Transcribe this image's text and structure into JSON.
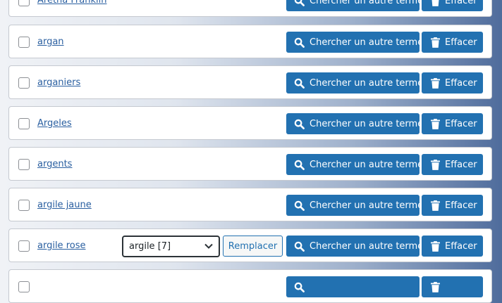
{
  "rows": [
    {
      "term": "Aretha Franklin",
      "search_label": "Chercher un autre terme",
      "clear_label": "Effacer"
    },
    {
      "term": "argan",
      "search_label": "Chercher un autre terme",
      "clear_label": "Effacer"
    },
    {
      "term": "arganiers",
      "search_label": "Chercher un autre terme",
      "clear_label": "Effacer"
    },
    {
      "term": "Argeles",
      "search_label": "Chercher un autre terme",
      "clear_label": "Effacer"
    },
    {
      "term": "argents",
      "search_label": "Chercher un autre terme",
      "clear_label": "Effacer"
    },
    {
      "term": "argile jaune",
      "search_label": "Chercher un autre terme",
      "clear_label": "Effacer"
    },
    {
      "term": "argile rose",
      "search_label": "Chercher un autre terme",
      "clear_label": "Effacer",
      "replacement_select": {
        "selected": "argile [7]"
      },
      "replace_label": "Remplacer"
    },
    {
      "term": "",
      "search_label": "",
      "clear_label": ""
    }
  ],
  "colors": {
    "primary_button": "#2271b1",
    "link": "#2a5fa0",
    "select_border": "#2c3338"
  },
  "icons": {
    "search": "search-icon",
    "clear": "trash-icon",
    "select": "chevron-down-icon"
  }
}
